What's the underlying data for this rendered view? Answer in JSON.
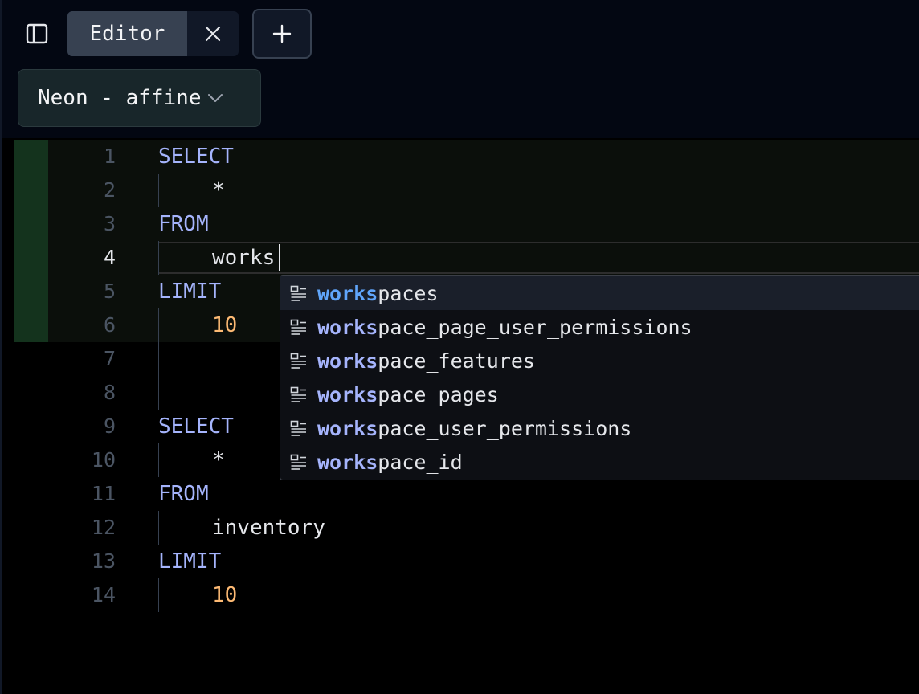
{
  "tabs": {
    "active_label": "Editor"
  },
  "connection": {
    "label": "Neon - affine"
  },
  "editor": {
    "lines": [
      {
        "num": "1",
        "text": "SELECT",
        "kind": "keyword"
      },
      {
        "num": "2",
        "text": "*",
        "kind": "plain"
      },
      {
        "num": "3",
        "text": "FROM",
        "kind": "keyword"
      },
      {
        "num": "4",
        "text": "works",
        "kind": "plain"
      },
      {
        "num": "5",
        "text": "LIMIT",
        "kind": "keyword"
      },
      {
        "num": "6",
        "text": "10",
        "kind": "number"
      },
      {
        "num": "7",
        "text": "",
        "kind": "plain"
      },
      {
        "num": "8",
        "text": "",
        "kind": "plain"
      },
      {
        "num": "9",
        "text": "SELECT",
        "kind": "keyword"
      },
      {
        "num": "10",
        "text": "*",
        "kind": "plain"
      },
      {
        "num": "11",
        "text": "FROM",
        "kind": "keyword"
      },
      {
        "num": "12",
        "text": "inventory",
        "kind": "plain"
      },
      {
        "num": "13",
        "text": "LIMIT",
        "kind": "keyword"
      },
      {
        "num": "14",
        "text": "10",
        "kind": "number"
      }
    ],
    "active_line": "4"
  },
  "autocomplete": {
    "typed": "works",
    "items": [
      {
        "match": "works",
        "rest": "paces"
      },
      {
        "match": "works",
        "rest": "pace_page_user_permissions"
      },
      {
        "match": "works",
        "rest": "pace_features"
      },
      {
        "match": "works",
        "rest": "pace_pages"
      },
      {
        "match": "works",
        "rest": "pace_user_permissions"
      },
      {
        "match": "works",
        "rest": "pace_id"
      }
    ]
  },
  "icons": {
    "sidebar_toggle": "sidebar-panel-icon",
    "close": "close-icon",
    "add": "plus-icon",
    "dropdown": "chevron-down-icon",
    "suggestion": "table-field-icon"
  },
  "colors": {
    "keyword": "#a5b4fc",
    "number": "#fdba74",
    "match_selected": "#60a5fa",
    "gutter_marker": "#14331d"
  }
}
